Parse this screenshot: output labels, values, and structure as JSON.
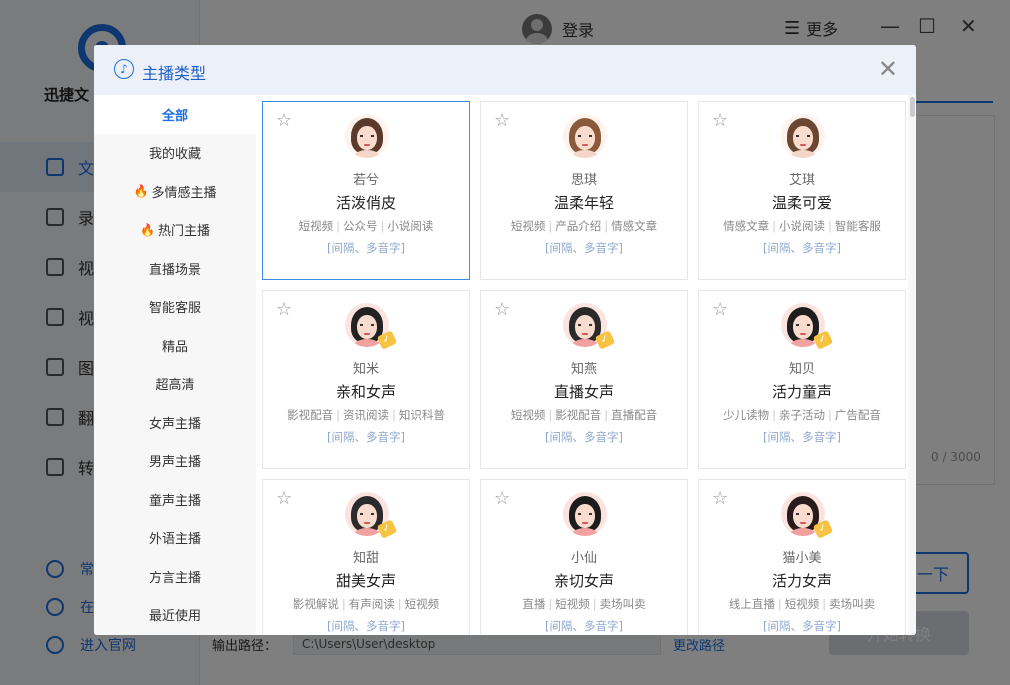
{
  "app": {
    "name": "迅捷文",
    "login_label": "登录",
    "more_label": "更多",
    "nav": [
      "文",
      "录",
      "视",
      "视",
      "图",
      "翻",
      "转"
    ],
    "bottom_nav": [
      "常",
      "在",
      "进入官网"
    ],
    "counter": "0 / 3000",
    "next_label": "一下",
    "convert_label": "开始转换",
    "output_label": "输出路径：",
    "output_path": "C:\\Users\\User\\desktop",
    "change_path_label": "更改路径"
  },
  "modal": {
    "title": "主播类型",
    "categories": [
      {
        "label": "全部",
        "active": true,
        "hot": false
      },
      {
        "label": "我的收藏",
        "active": false,
        "hot": false
      },
      {
        "label": "多情感主播",
        "active": false,
        "hot": true
      },
      {
        "label": "热门主播",
        "active": false,
        "hot": true
      },
      {
        "label": "直播场景",
        "active": false,
        "hot": false
      },
      {
        "label": "智能客服",
        "active": false,
        "hot": false
      },
      {
        "label": "精品",
        "active": false,
        "hot": false
      },
      {
        "label": "超高清",
        "active": false,
        "hot": false
      },
      {
        "label": "女声主播",
        "active": false,
        "hot": false
      },
      {
        "label": "男声主播",
        "active": false,
        "hot": false
      },
      {
        "label": "童声主播",
        "active": false,
        "hot": false
      },
      {
        "label": "外语主播",
        "active": false,
        "hot": false
      },
      {
        "label": "方言主播",
        "active": false,
        "hot": false
      },
      {
        "label": "最近使用",
        "active": false,
        "hot": false
      }
    ],
    "speakers": [
      {
        "nick": "若兮",
        "style": "活泼俏皮",
        "tags": [
          "短视频",
          "公众号",
          "小说阅读"
        ],
        "feature": "[间隔、多音字]",
        "vip": false,
        "selected": true,
        "hair_color": "#5a3a2a",
        "realistic": true
      },
      {
        "nick": "思琪",
        "style": "温柔年轻",
        "tags": [
          "短视频",
          "产品介绍",
          "情感文章"
        ],
        "feature": "[间隔、多音字]",
        "vip": false,
        "selected": false,
        "hair_color": "#8a5a3a",
        "realistic": true
      },
      {
        "nick": "艾琪",
        "style": "温柔可爱",
        "tags": [
          "情感文章",
          "小说阅读",
          "智能客服"
        ],
        "feature": "[间隔、多音字]",
        "vip": false,
        "selected": false,
        "hair_color": "#6b4632",
        "realistic": true
      },
      {
        "nick": "知米",
        "style": "亲和女声",
        "tags": [
          "影视配音",
          "资讯阅读",
          "知识科普"
        ],
        "feature": "[间隔、多音字]",
        "vip": true,
        "selected": false,
        "hair_color": "#222222",
        "realistic": false
      },
      {
        "nick": "知燕",
        "style": "直播女声",
        "tags": [
          "短视频",
          "影视配音",
          "直播配音"
        ],
        "feature": "[间隔、多音字]",
        "vip": true,
        "selected": false,
        "hair_color": "#2a2a2a",
        "realistic": false
      },
      {
        "nick": "知贝",
        "style": "活力童声",
        "tags": [
          "少儿读物",
          "亲子活动",
          "广告配音"
        ],
        "feature": "[间隔、多音字]",
        "vip": true,
        "selected": false,
        "hair_color": "#1e1e1e",
        "realistic": false
      },
      {
        "nick": "知甜",
        "style": "甜美女声",
        "tags": [
          "影视解说",
          "有声阅读",
          "短视频"
        ],
        "feature": "[间隔、多音字]",
        "vip": true,
        "selected": false,
        "hair_color": "#2b2b2b",
        "realistic": false
      },
      {
        "nick": "小仙",
        "style": "亲切女声",
        "tags": [
          "直播",
          "短视频",
          "卖场叫卖"
        ],
        "feature": "[间隔、多音字]",
        "vip": false,
        "selected": false,
        "hair_color": "#1c1c1c",
        "realistic": false
      },
      {
        "nick": "猫小美",
        "style": "活力女声",
        "tags": [
          "线上直播",
          "短视频",
          "卖场叫卖"
        ],
        "feature": "[间隔、多音字]",
        "vip": true,
        "selected": false,
        "hair_color": "#2a1a1a",
        "realistic": false
      }
    ]
  },
  "colors": {
    "accent": "#1d6fe0",
    "feature_text": "#8fa8cf",
    "hot": "#f0562a",
    "vip": "#f7c343"
  }
}
